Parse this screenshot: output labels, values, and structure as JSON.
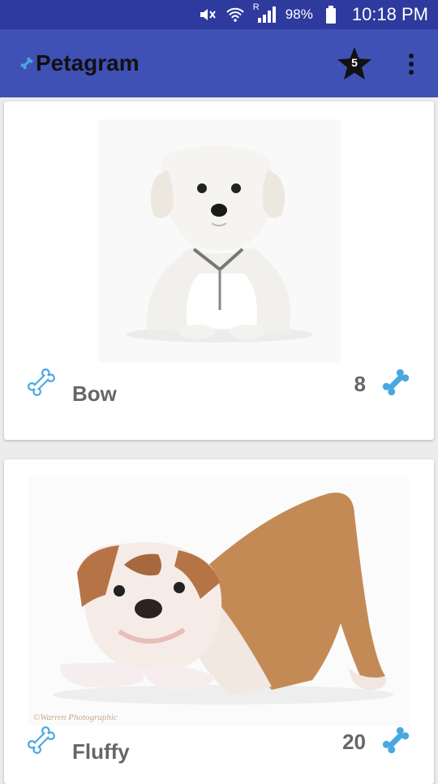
{
  "status_bar": {
    "signal_label": "R",
    "battery": "98%",
    "time": "10:18 PM"
  },
  "app_bar": {
    "title": "Petagram",
    "favorites_count": "5",
    "icons": [
      "bone-icon",
      "star-icon",
      "overflow-menu-icon"
    ]
  },
  "pets": [
    {
      "name": "Bow",
      "likes": "8",
      "photo": "white-puppy-photo"
    },
    {
      "name": "Fluffy",
      "likes": "20",
      "photo": "bulldog-puppy-photo",
      "photo_credit": "©Warren Photographic"
    }
  ],
  "colors": {
    "status_bar": "#2f3a9e",
    "app_bar": "#3f51b5",
    "bone": "#4aa8e0",
    "text_gray": "#666666"
  }
}
